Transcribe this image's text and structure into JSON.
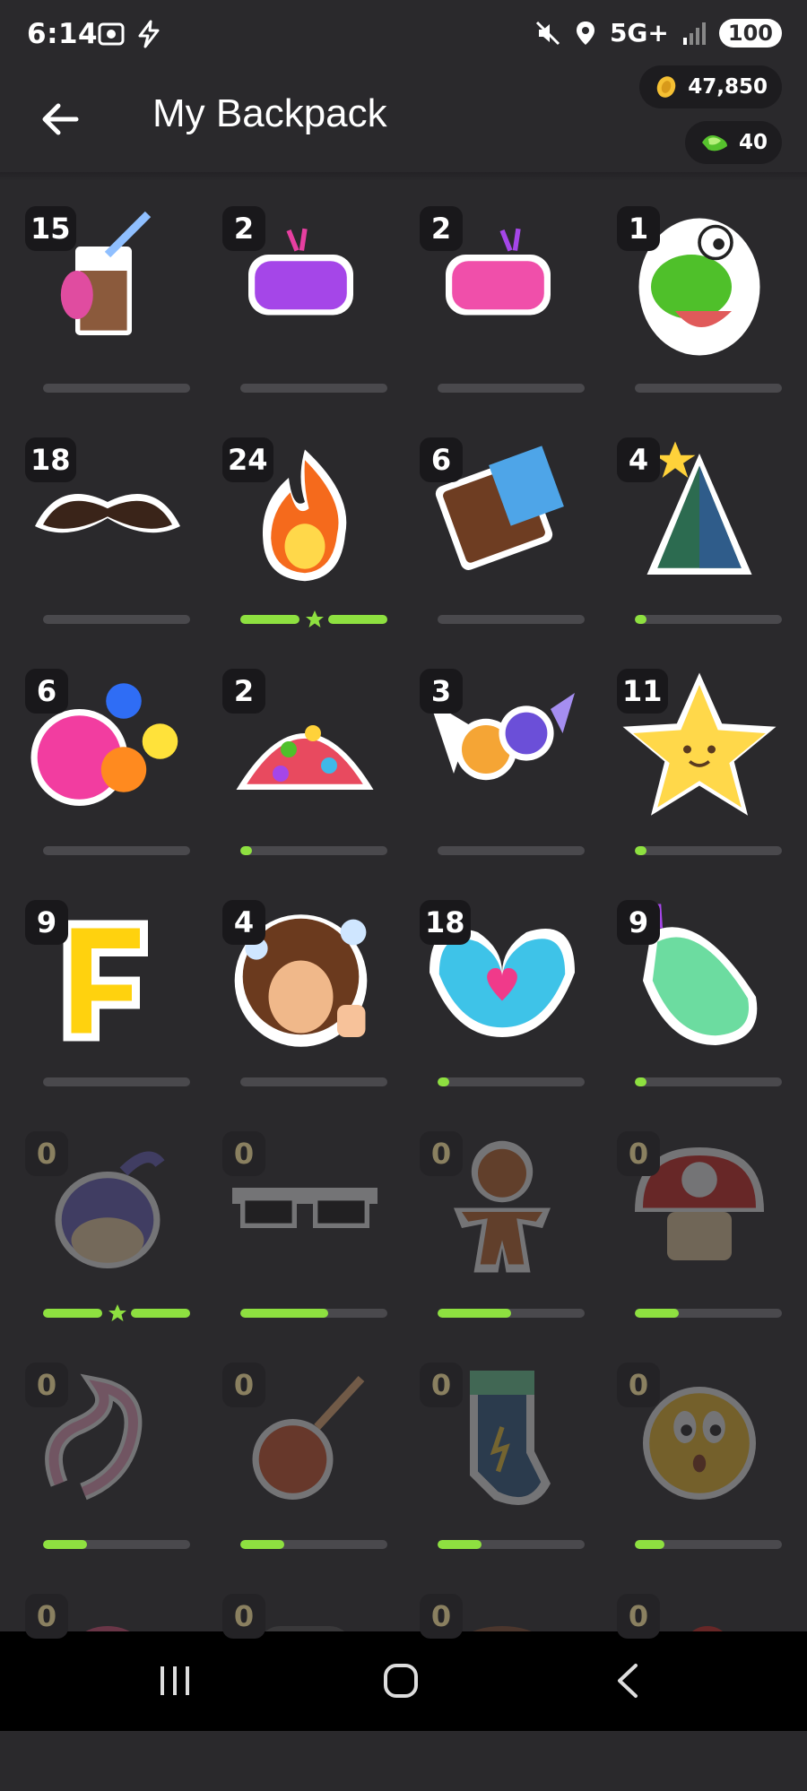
{
  "status": {
    "time": "6:14",
    "network": "5G+",
    "battery": "100"
  },
  "header": {
    "title": "My Backpack",
    "coins": "47,850",
    "gems": "40"
  },
  "items": [
    {
      "name": "iced-chocolate-drink",
      "count": "15",
      "progress": 0
    },
    {
      "name": "purple-fist",
      "count": "2",
      "progress": 0
    },
    {
      "name": "pink-fist",
      "count": "2",
      "progress": 0
    },
    {
      "name": "green-dinosaur",
      "count": "1",
      "progress": 0
    },
    {
      "name": "mustache",
      "count": "18",
      "progress": 0
    },
    {
      "name": "fire",
      "count": "24",
      "progress": 1,
      "star": true
    },
    {
      "name": "chocolate-bar",
      "count": "6",
      "progress": 0
    },
    {
      "name": "christmas-tree",
      "count": "4",
      "progress": 0.08
    },
    {
      "name": "gumballs",
      "count": "6",
      "progress": 0
    },
    {
      "name": "jelly-beans",
      "count": "2",
      "progress": 0.08
    },
    {
      "name": "wrapped-candies",
      "count": "3",
      "progress": 0
    },
    {
      "name": "smiling-star",
      "count": "11",
      "progress": 0.08
    },
    {
      "name": "letter-f",
      "count": "9",
      "progress": 0
    },
    {
      "name": "bob-ross",
      "count": "4",
      "progress": 0
    },
    {
      "name": "heart-hands",
      "count": "18",
      "progress": 0.08
    },
    {
      "name": "clapping-hands",
      "count": "9",
      "progress": 0.08
    },
    {
      "name": "pufferfish",
      "count": "0",
      "progress": 1,
      "star": true,
      "dim": true
    },
    {
      "name": "pixel-sunglasses",
      "count": "0",
      "progress": 0.6,
      "dim": true
    },
    {
      "name": "gingerbread-man",
      "count": "0",
      "progress": 0.5,
      "dim": true
    },
    {
      "name": "mushroom",
      "count": "0",
      "progress": 0.3,
      "dim": true
    },
    {
      "name": "sprinkle-streamer",
      "count": "0",
      "progress": 0.3,
      "dim": true
    },
    {
      "name": "meteor",
      "count": "0",
      "progress": 0.3,
      "dim": true
    },
    {
      "name": "stocking",
      "count": "0",
      "progress": 0.3,
      "dim": true
    },
    {
      "name": "worried-face",
      "count": "0",
      "progress": 0.2,
      "dim": true
    },
    {
      "name": "partial-item-1",
      "count": "0",
      "progress": 0,
      "dim": true
    },
    {
      "name": "partial-item-2",
      "count": "0",
      "progress": 0,
      "dim": true
    },
    {
      "name": "partial-item-3",
      "count": "0",
      "progress": 0,
      "dim": true
    },
    {
      "name": "partial-item-4",
      "count": "0",
      "progress": 0,
      "dim": true
    }
  ],
  "colors": {
    "accent_green": "#8ee040",
    "background": "#2a292c",
    "badge": "#19181b"
  }
}
